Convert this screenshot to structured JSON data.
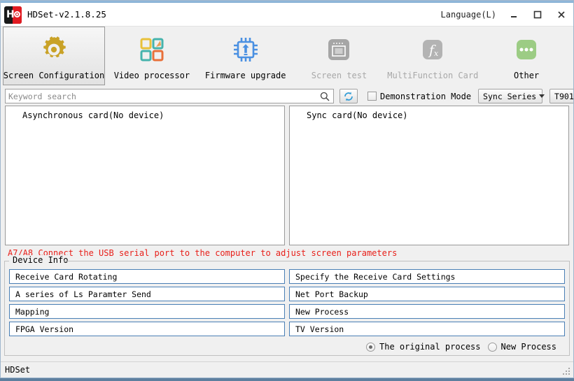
{
  "window": {
    "title": "HDSet-v2.1.8.25",
    "logo_icon": "hd-logo-icon",
    "language_menu": "Language(L)",
    "minimize_icon": "minimize-icon",
    "maximize_icon": "maximize-icon",
    "close_icon": "close-icon"
  },
  "toolbar": {
    "items": [
      {
        "label": "Screen Configuration",
        "icon": "gear-icon",
        "selected": true,
        "disabled": false
      },
      {
        "label": "Video processor",
        "icon": "four-squares-icon",
        "selected": false,
        "disabled": false
      },
      {
        "label": "Firmware upgrade",
        "icon": "chip-upload-icon",
        "selected": false,
        "disabled": false
      },
      {
        "label": "Screen test",
        "icon": "screen-test-icon",
        "selected": false,
        "disabled": true
      },
      {
        "label": "MultiFunction Card",
        "icon": "fx-icon",
        "selected": false,
        "disabled": true
      },
      {
        "label": "Other",
        "icon": "ellipsis-icon",
        "selected": false,
        "disabled": false
      }
    ]
  },
  "search": {
    "value": "",
    "placeholder": "Keyword search",
    "search_icon": "search-icon",
    "refresh_icon": "refresh-icon",
    "demonstration_mode_label": "Demonstration Mode",
    "demonstration_mode_checked": false,
    "series_combo_value": "Sync Series",
    "model_combo_value": "T901"
  },
  "panels": {
    "left_title": "Asynchronous card(No device)",
    "right_title": "Sync card(No device)"
  },
  "warning": {
    "text": "A7/A8 Connect the USB serial port to the computer to adjust screen parameters"
  },
  "device_info": {
    "group_title": "Device Info",
    "left_buttons": [
      "Receive Card Rotating",
      "A series of Ls Paramter Send",
      "Mapping",
      "FPGA Version"
    ],
    "right_buttons": [
      "Specify the Receive Card Settings",
      "Net Port Backup",
      "New Process",
      "TV Version"
    ],
    "radios": [
      {
        "label": "The original process",
        "checked": true
      },
      {
        "label": "New Process",
        "checked": false
      }
    ]
  },
  "statusbar": {
    "text": "HDSet",
    "grip_icon": "resize-grip-icon"
  },
  "colors": {
    "accent_blue": "#4a7fb5",
    "warning_red": "#e8201a",
    "gear_gold": "#c9a227",
    "chip_blue": "#4a90e2",
    "other_green": "#9ccc84",
    "disabled_gray": "#a8a8a8"
  }
}
